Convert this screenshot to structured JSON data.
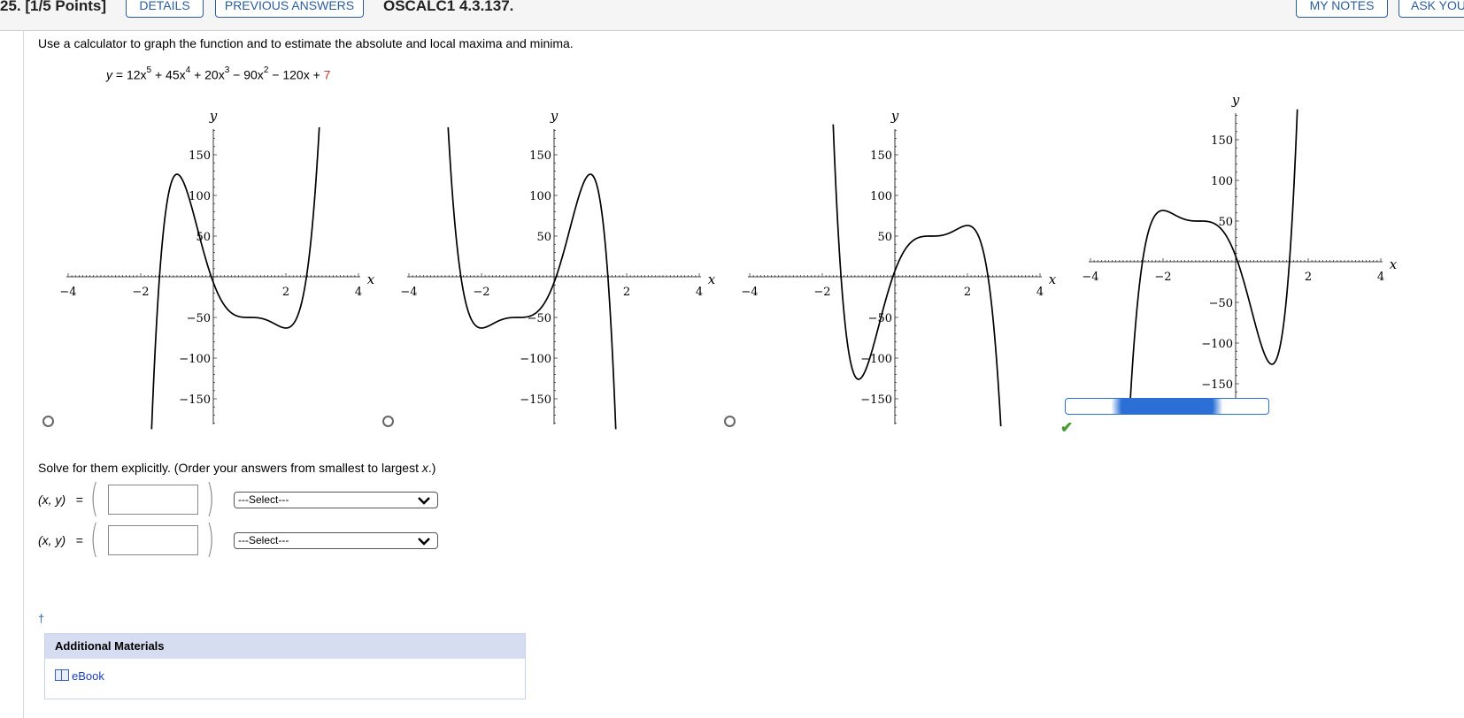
{
  "header": {
    "question_label": "25.  [1/5 Points]",
    "details_label": "DETAILS",
    "previous_answers_label": "PREVIOUS ANSWERS",
    "problem_code": "OSCALC1 4.3.137.",
    "my_notes_label": "MY NOTES",
    "ask_label": "ASK YOU"
  },
  "question": {
    "instruction": "Use a calculator to graph the function and to estimate the absolute and local maxima and minima.",
    "function": {
      "lhs": "y",
      "terms": [
        "= 12x",
        "5",
        " + 45x",
        "4",
        " + 20x",
        "3",
        " − 90x",
        "2",
        " − 120x + "
      ],
      "constant": "7"
    }
  },
  "graphs": {
    "axis_x_label": "x",
    "axis_y_label": "y",
    "x_ticks": [
      "−4",
      "−2",
      "2",
      "4"
    ],
    "y_ticks": [
      "150",
      "100",
      "50",
      "−50",
      "−100",
      "−150"
    ],
    "selected_option": 4,
    "correct_mark": "✔"
  },
  "chart_data": [
    {
      "type": "line",
      "option": 1,
      "description_expr": "-(p(-x))",
      "xlim": [
        -4,
        4
      ],
      "ylim": [
        -180,
        180
      ],
      "series": [
        {
          "values_from": "reflected"
        }
      ]
    },
    {
      "type": "line",
      "option": 2,
      "xlim": [
        -4,
        4
      ],
      "ylim": [
        -180,
        180
      ]
    },
    {
      "type": "line",
      "option": 3,
      "xlim": [
        -4,
        4
      ],
      "ylim": [
        -180,
        180
      ]
    },
    {
      "type": "line",
      "option": 4,
      "function": "12x^5 + 45x^4 + 20x^3 - 90x^2 - 120x + 7",
      "xlim": [
        -4,
        4
      ],
      "ylim": [
        -180,
        180
      ]
    }
  ],
  "solve": {
    "prompt_main": "Solve for them explicitly. (Order your answers from smallest to largest ",
    "prompt_var": "x",
    "prompt_end": ".)",
    "rows": [
      {
        "label": "(x, y)",
        "eq": "=",
        "value": "",
        "select": "---Select---"
      },
      {
        "label": "(x, y)",
        "eq": "=",
        "value": "",
        "select": "---Select---"
      }
    ]
  },
  "footer": {
    "dagger": "†",
    "additional_materials_title": "Additional Materials",
    "ebook_label": "eBook"
  }
}
